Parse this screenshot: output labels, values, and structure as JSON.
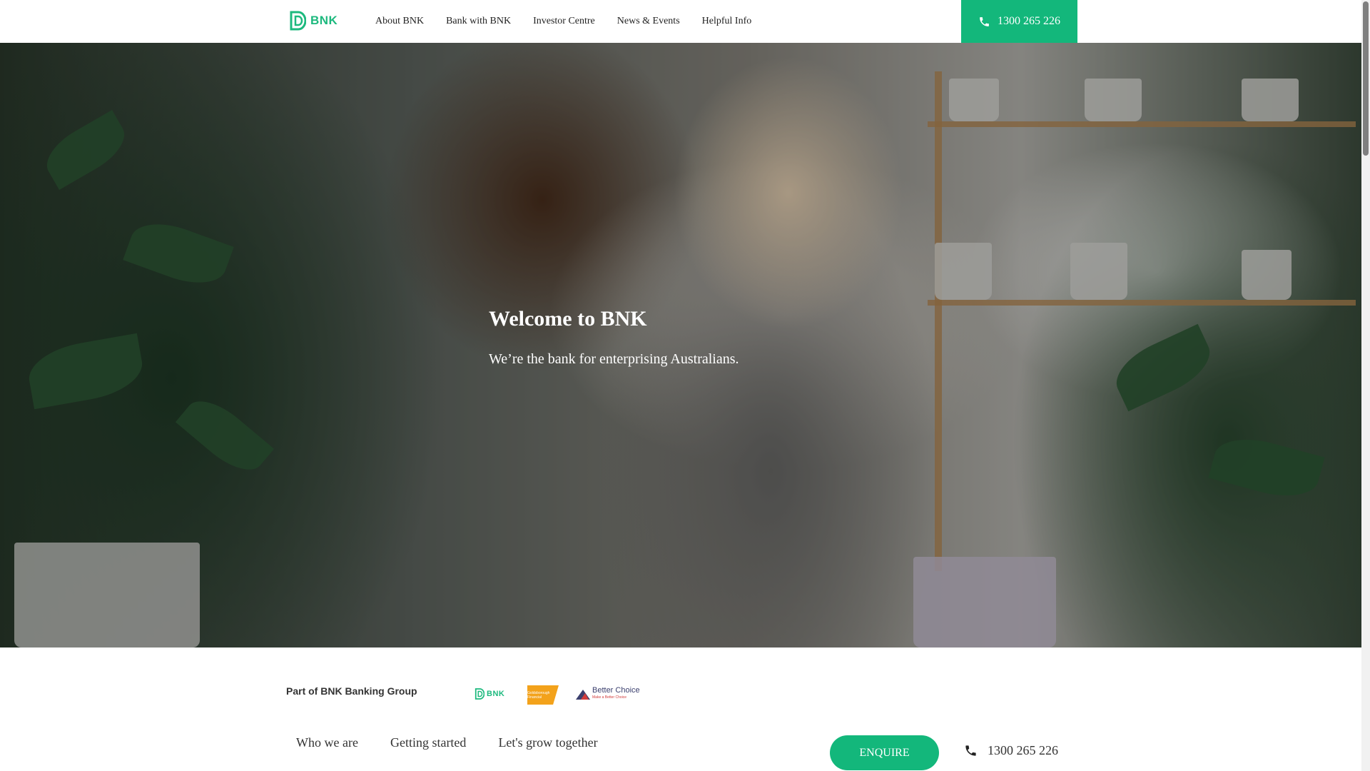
{
  "brand": {
    "name": "BNK",
    "accent": "#13b77b",
    "logo_green": "#1db97e"
  },
  "header": {
    "nav": [
      "About BNK",
      "Bank with BNK",
      "Investor Centre",
      "News & Events",
      "Helpful Info"
    ],
    "phone": {
      "icon": "phone-icon",
      "number": "1300 265 226"
    }
  },
  "hero": {
    "title": "Welcome to BNK",
    "subtitle": "We’re the bank for enterprising Australians."
  },
  "group": {
    "label": "Part of BNK Banking Group",
    "partners": [
      "BNK",
      "Goldsborough Financial",
      "Better Choice"
    ],
    "better_choice_tagline": "Make a Better Choice"
  },
  "bottom_bar": {
    "nav": [
      "Who we are",
      "Getting started",
      "Let's grow together"
    ],
    "enquire_label": "ENQUIRE",
    "phone": {
      "icon": "phone-icon",
      "number": "1300 265 226"
    }
  }
}
